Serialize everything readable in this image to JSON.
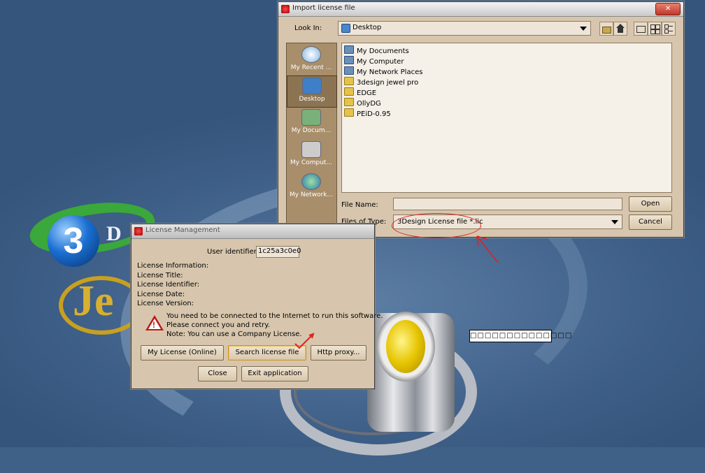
{
  "desktop": {
    "logo_digit": "3",
    "logo_d": "D",
    "logo_je": "Je",
    "tooltip_text": "□□□□□□□□□□□□□□"
  },
  "import_dialog": {
    "title": "Import license file",
    "close_label": "✕",
    "look_in_label": "Look In:",
    "look_in_value": "Desktop",
    "sidebar": [
      {
        "label": "My Recent ...",
        "icon": "recent-documents-icon"
      },
      {
        "label": "Desktop",
        "icon": "desktop-icon",
        "selected": true
      },
      {
        "label": "My Docum...",
        "icon": "my-documents-icon"
      },
      {
        "label": "My Comput...",
        "icon": "my-computer-icon"
      },
      {
        "label": "My Network...",
        "icon": "network-places-icon"
      }
    ],
    "files": [
      {
        "name": "My Documents",
        "icon": "my-documents-icon"
      },
      {
        "name": "My Computer",
        "icon": "my-computer-icon"
      },
      {
        "name": "My Network Places",
        "icon": "network-places-icon"
      },
      {
        "name": "3design jewel pro",
        "icon": "folder-icon"
      },
      {
        "name": "EDGE",
        "icon": "folder-icon"
      },
      {
        "name": "OllyDG",
        "icon": "folder-icon"
      },
      {
        "name": "PEiD-0.95",
        "icon": "folder-icon"
      }
    ],
    "file_name_label": "File Name:",
    "file_name_value": "",
    "files_of_type_label": "Files of Type:",
    "files_of_type_value": "3Design License file *.lic",
    "open_label": "Open",
    "cancel_label": "Cancel"
  },
  "license_dialog": {
    "title": "License Management",
    "user_identifier_label": "User identifier",
    "user_identifier_value": "1c25a3c0e0",
    "info_lines": [
      "License Information:",
      "License Title:",
      "License Identifier:",
      "License Date:",
      "License Version:"
    ],
    "warning_lines": [
      "You need to be connected to the Internet to run this software.",
      "Please connect you and retry.",
      "Note: You can use a Company License."
    ],
    "my_license_label": "My License (Online)",
    "search_license_label": "Search license file",
    "http_proxy_label": "Http proxy...",
    "close_label": "Close",
    "exit_label": "Exit application"
  },
  "colors": {
    "desktop_bg": "#3f6187",
    "dialog_bg": "#d7c6ad",
    "annotation_red": "#e02020"
  }
}
